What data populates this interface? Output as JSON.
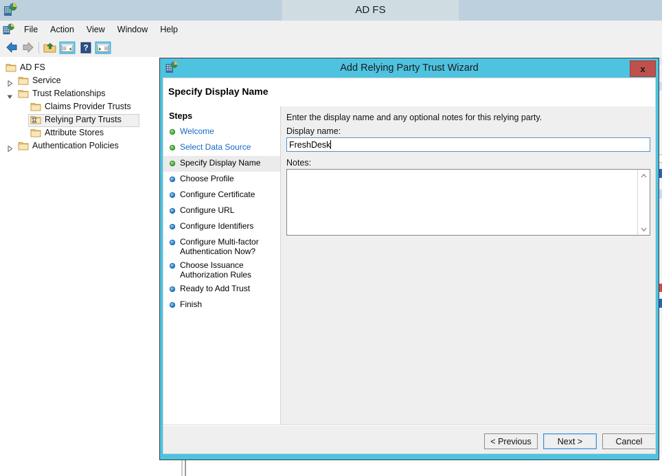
{
  "window": {
    "title": "AD FS",
    "app_icon": "adfs-console-icon",
    "menu": [
      "File",
      "Action",
      "View",
      "Window",
      "Help"
    ],
    "toolbar": [
      {
        "name": "back-arrow-icon",
        "enabled": true
      },
      {
        "name": "forward-arrow-icon",
        "enabled": false
      },
      {
        "name": "up-folder-icon",
        "enabled": true
      },
      {
        "name": "show-hide-console-tree-icon",
        "enabled": true
      },
      {
        "name": "help-icon",
        "enabled": true
      },
      {
        "name": "show-hide-action-pane-icon",
        "enabled": true
      }
    ]
  },
  "tree": {
    "items": [
      {
        "label": "AD FS",
        "depth": 0,
        "expander": "none",
        "selected": false,
        "icon": "folder-icon"
      },
      {
        "label": "Service",
        "depth": 1,
        "expander": "collapsed",
        "selected": false,
        "icon": "folder-icon"
      },
      {
        "label": "Trust Relationships",
        "depth": 1,
        "expander": "expanded",
        "selected": false,
        "icon": "folder-icon"
      },
      {
        "label": "Claims Provider Trusts",
        "depth": 2,
        "expander": "none",
        "selected": false,
        "icon": "folder-icon"
      },
      {
        "label": "Relying Party Trusts",
        "depth": 2,
        "expander": "none",
        "selected": true,
        "icon": "folder-busy-icon"
      },
      {
        "label": "Attribute Stores",
        "depth": 2,
        "expander": "none",
        "selected": false,
        "icon": "folder-icon"
      },
      {
        "label": "Authentication Policies",
        "depth": 1,
        "expander": "collapsed",
        "selected": false,
        "icon": "folder-icon"
      }
    ]
  },
  "wizard": {
    "title": "Add Relying Party Trust Wizard",
    "icon": "adfs-wizard-icon",
    "close_label": "x",
    "page_heading": "Specify Display Name",
    "steps_heading": "Steps",
    "steps": [
      {
        "label": "Welcome",
        "state": "done",
        "link": true
      },
      {
        "label": "Select Data Source",
        "state": "done",
        "link": true
      },
      {
        "label": "Specify Display Name",
        "state": "current",
        "link": false
      },
      {
        "label": "Choose Profile",
        "state": "todo",
        "link": false
      },
      {
        "label": "Configure Certificate",
        "state": "todo",
        "link": false
      },
      {
        "label": "Configure URL",
        "state": "todo",
        "link": false
      },
      {
        "label": "Configure Identifiers",
        "state": "todo",
        "link": false
      },
      {
        "label": "Configure Multi-factor Authentication Now?",
        "state": "todo",
        "link": false
      },
      {
        "label": "Choose Issuance Authorization Rules",
        "state": "todo",
        "link": false
      },
      {
        "label": "Ready to Add Trust",
        "state": "todo",
        "link": false
      },
      {
        "label": "Finish",
        "state": "todo",
        "link": false
      }
    ],
    "content": {
      "intro": "Enter the display name and any optional notes for this relying party.",
      "display_name_label": "Display name:",
      "display_name_value": "FreshDesk",
      "display_name_placeholder": "",
      "notes_label": "Notes:",
      "notes_value": "",
      "notes_placeholder": "",
      "scroll_up_icon": "chevron-up-icon",
      "scroll_down_icon": "chevron-down-icon"
    },
    "buttons": {
      "previous": "< Previous",
      "next": "Next >",
      "cancel": "Cancel"
    }
  },
  "colors": {
    "dialog_border": "#4ec3e0",
    "close_button": "#c0504d",
    "step_done": "#4ab83a",
    "step_todo": "#2a86d8",
    "link_text": "#1569c7",
    "titlebar": "#bdd0dd",
    "focus_border": "#3a8dde"
  }
}
